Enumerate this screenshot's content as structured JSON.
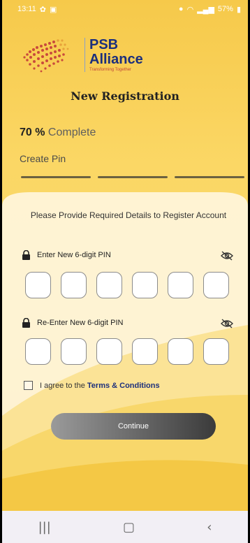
{
  "status": {
    "time": "13:11",
    "battery": "57%"
  },
  "brand": {
    "line1": "PSB",
    "line2": "Alliance",
    "tagline": "Transforming Together"
  },
  "page": {
    "title": "New Registration"
  },
  "progress": {
    "percent_text": "70 %",
    "word": "Complete",
    "step": "Create Pin",
    "value": 0.7
  },
  "form": {
    "instructions": "Please Provide Required Details to Register Account",
    "pin_label": "Enter New 6-digit PIN",
    "repin_label": "Re-Enter New 6-digit PIN",
    "agree_text": "I agree to the ",
    "terms_link": "Terms & Conditions",
    "continue_label": "Continue"
  },
  "colors": {
    "accent": "#1c2f7c",
    "background": "#f6c94a"
  }
}
